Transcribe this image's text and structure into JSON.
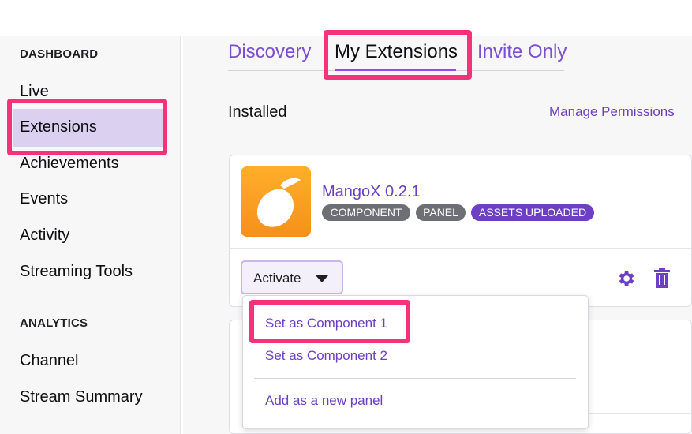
{
  "sidebar": {
    "dashboard_heading": "DASHBOARD",
    "items": [
      {
        "label": "Live"
      },
      {
        "label": "Extensions"
      },
      {
        "label": "Achievements"
      },
      {
        "label": "Events"
      },
      {
        "label": "Activity"
      },
      {
        "label": "Streaming Tools"
      }
    ],
    "analytics_heading": "ANALYTICS",
    "analytics_items": [
      {
        "label": "Channel"
      },
      {
        "label": "Stream Summary"
      }
    ]
  },
  "tabs": [
    {
      "label": "Discovery"
    },
    {
      "label": "My Extensions"
    },
    {
      "label": "Invite Only"
    }
  ],
  "installed_section": {
    "title": "Installed",
    "manage_link": "Manage Permissions"
  },
  "extension": {
    "name": "MangoX 0.2.1",
    "icon": "mango-icon",
    "badges": [
      "COMPONENT",
      "PANEL",
      "ASSETS UPLOADED"
    ],
    "activate_label": "Activate",
    "settings_icon": "gear-icon",
    "delete_icon": "trash-icon"
  },
  "activate_menu": {
    "items": [
      {
        "label": "Set as Component 1"
      },
      {
        "label": "Set as Component 2"
      },
      {
        "label": "Add as a new panel"
      }
    ]
  },
  "colors": {
    "accent": "#6c3fc4",
    "highlight": "#f6337a",
    "active_bg": "#dcd0f1",
    "icon_orange": "#f6901a"
  }
}
